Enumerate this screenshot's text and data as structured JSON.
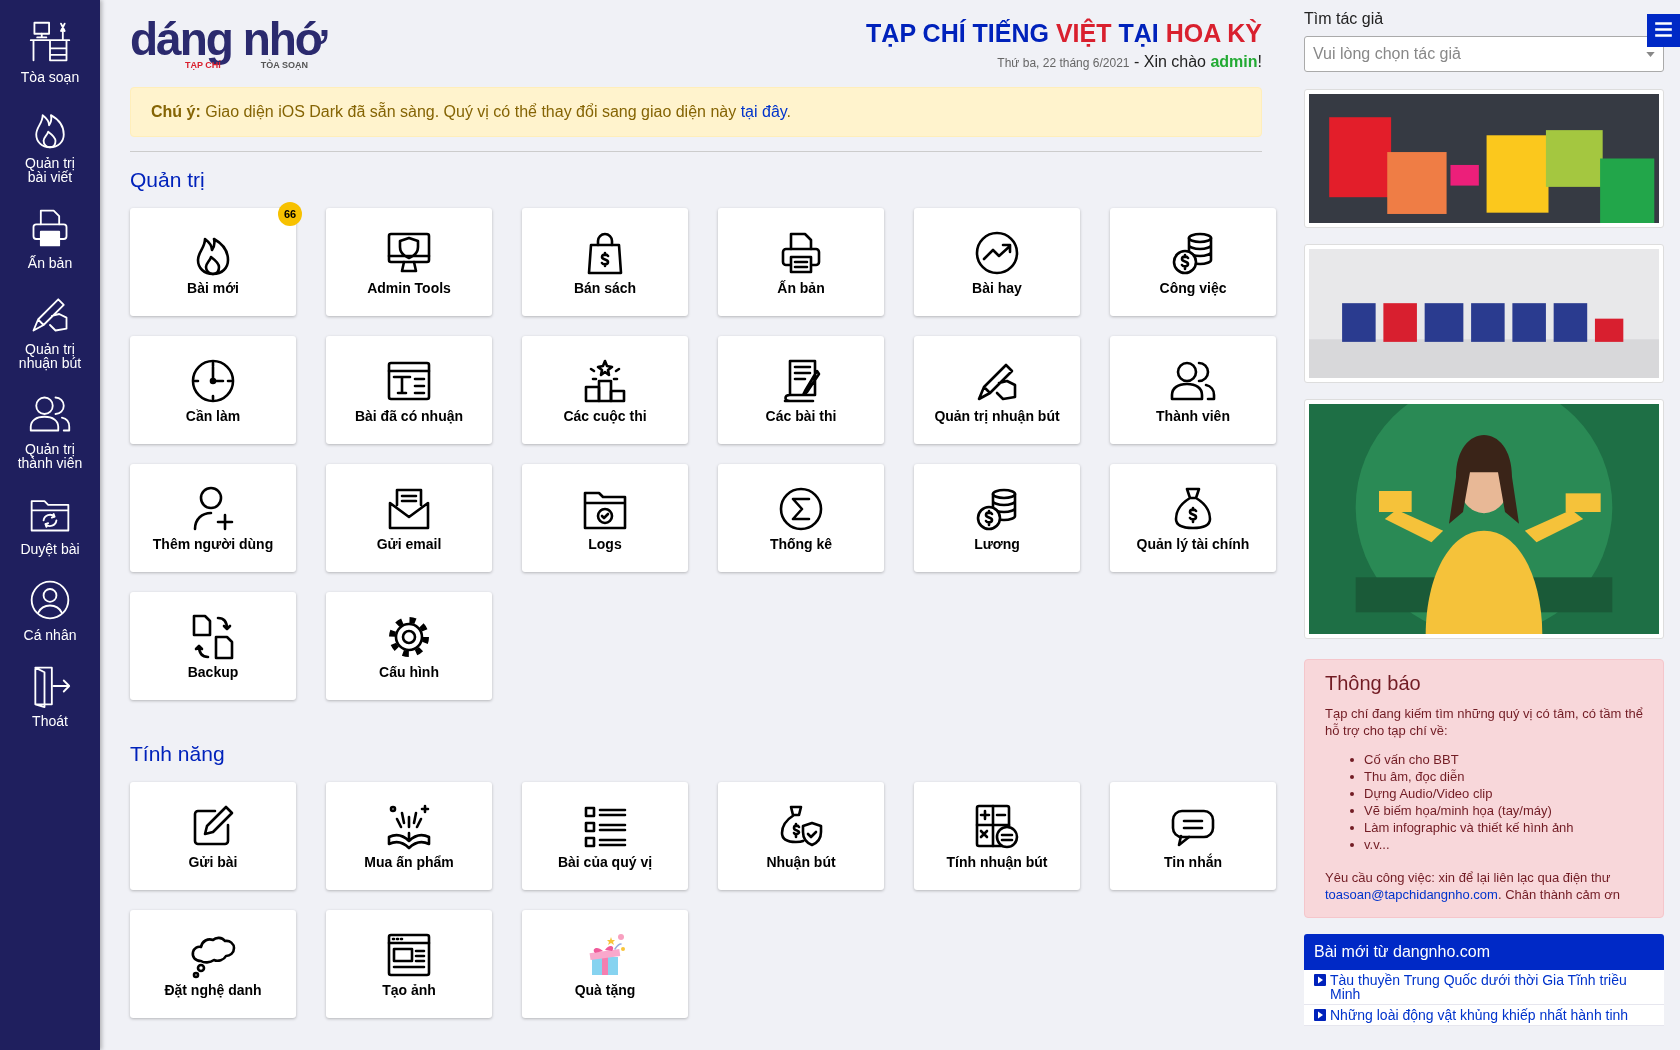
{
  "sidebar": {
    "items": [
      {
        "label": "Tòa soạn"
      },
      {
        "label": "Quản trị bài viết"
      },
      {
        "label": "Ấn bản"
      },
      {
        "label": "Quản trị nhuận bút"
      },
      {
        "label": "Quản trị thành viên"
      },
      {
        "label": "Duyệt bài"
      },
      {
        "label": "Cá nhân"
      },
      {
        "label": "Thoát"
      }
    ]
  },
  "header": {
    "logo": {
      "name": "dáng nhớ",
      "left_tag": "TẠP CHÍ",
      "right_tag": "TÒA SOẠN"
    },
    "title": [
      {
        "text": "TẠP CHÍ TIẾNG ",
        "color": "#0022bb"
      },
      {
        "text": "VIỆT",
        "color": "#d9202e"
      },
      {
        "text": " TẠI ",
        "color": "#0022bb"
      },
      {
        "text": "HOA KỲ",
        "color": "#d9202e"
      }
    ],
    "date": "Thứ ba, 22 tháng 6/2021",
    "greeting": {
      "prefix": " - Xin chào ",
      "user": "admin",
      "suffix": "!"
    }
  },
  "alert": {
    "text": "**Chú ý:** Giao diện iOS Dark đã sẵn sàng. Quý vị có thể thay đổi sang giao diện này ",
    "link": "tại đây",
    "after": "."
  },
  "sections": [
    {
      "title": "Quản trị",
      "tiles": [
        {
          "label": "Bài mới",
          "badge": "66"
        },
        {
          "label": "Admin Tools"
        },
        {
          "label": "Bán sách"
        },
        {
          "label": "Ấn bản"
        },
        {
          "label": "Bài hay"
        },
        {
          "label": "Công việc"
        },
        {
          "label": "Cần làm"
        },
        {
          "label": "Bài đã có nhuận"
        },
        {
          "label": "Các cuộc thi"
        },
        {
          "label": "Các bài thi"
        },
        {
          "label": "Quản trị nhuận bút"
        },
        {
          "label": "Thành viên"
        },
        {
          "label": "Thêm người dùng"
        },
        {
          "label": "Gửi email"
        },
        {
          "label": "Logs"
        },
        {
          "label": "Thống kê"
        },
        {
          "label": "Lương"
        },
        {
          "label": "Quản lý tài chính"
        },
        {
          "label": "Backup"
        },
        {
          "label": "Cấu hình"
        }
      ]
    },
    {
      "title": "Tính năng",
      "tiles": [
        {
          "label": "Gửi bài"
        },
        {
          "label": "Mua ấn phẩm"
        },
        {
          "label": "Bài của quý vị"
        },
        {
          "label": "Nhuận bút"
        },
        {
          "label": "Tính nhuận bút"
        },
        {
          "label": "Tin nhắn"
        },
        {
          "label": "Đặt nghệ danh"
        },
        {
          "label": "Tạo ảnh"
        },
        {
          "label": "Quà tặng"
        }
      ]
    }
  ],
  "author_search": {
    "label": "Tìm tác giả",
    "placeholder": "Vui lòng chọn tác giả"
  },
  "notice": {
    "title": "Thông báo",
    "intro": "Tạp chí đang kiếm tìm những quý vị có tâm, có tầm thể hỗ trợ cho tạp chí về:",
    "items": [
      "Cố vấn cho BBT",
      "Thu âm, đọc diễn",
      "Dựng Audio/Video clip",
      "Vẽ biếm họa/minh họa (tay/máy)",
      "Làm infographic và thiết kế hình ảnh",
      "v.v..."
    ],
    "footer": "Yêu cầu công việc: xin để lại liên lạc qua điện thư ",
    "email": "toasoan@tapchidangnho.com",
    "footer_after": ". Chân thành cảm ơn"
  },
  "news": {
    "title": "Bài mới từ dangnho.com",
    "items": [
      "Tàu thuyền Trung Quốc dưới thời Gia Tĩnh triều Minh",
      "Những loài động vật khủng khiếp nhất hành tinh"
    ]
  }
}
